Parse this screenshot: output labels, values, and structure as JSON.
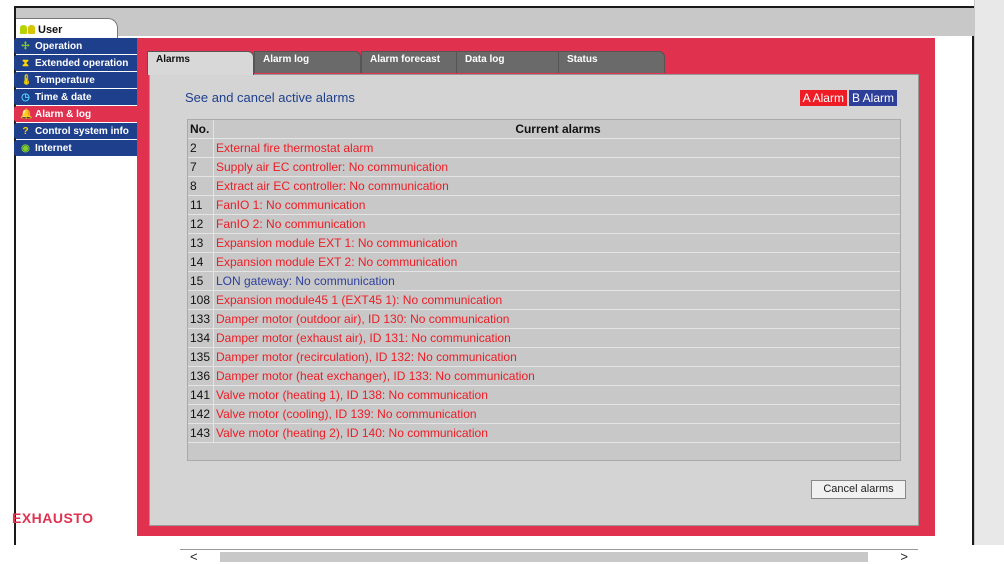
{
  "user_tab": {
    "label": "User"
  },
  "sidebar": {
    "items": [
      {
        "label": "Operation",
        "icon": "fan-icon"
      },
      {
        "label": "Extended operation",
        "icon": "hourglass-icon"
      },
      {
        "label": "Temperature",
        "icon": "thermometer-icon"
      },
      {
        "label": "Time & date",
        "icon": "clock-icon"
      },
      {
        "label": "Alarm & log",
        "icon": "bell-icon",
        "active": true
      },
      {
        "label": "Control system info",
        "icon": "question-icon"
      },
      {
        "label": "Internet",
        "icon": "globe-icon"
      }
    ]
  },
  "logo": {
    "text": "EXHAUSTO"
  },
  "tabs": [
    {
      "label": "Alarms",
      "active": true
    },
    {
      "label": "Alarm log"
    },
    {
      "label": "Alarm forecast"
    },
    {
      "label": "Data log"
    },
    {
      "label": "Status"
    }
  ],
  "main": {
    "heading": "See and cancel active alarms",
    "legend": {
      "a": "A Alarm",
      "b": "B Alarm"
    },
    "table": {
      "col_no": "No.",
      "col_text": "Current alarms",
      "rows": [
        {
          "no": "2",
          "text": "External fire thermostat alarm",
          "class": "A"
        },
        {
          "no": "7",
          "text": "Supply air EC controller: No communication",
          "class": "A"
        },
        {
          "no": "8",
          "text": "Extract air EC controller: No communication",
          "class": "A"
        },
        {
          "no": "11",
          "text": "FanIO 1: No communication",
          "class": "A"
        },
        {
          "no": "12",
          "text": "FanIO 2: No communication",
          "class": "A"
        },
        {
          "no": "13",
          "text": "Expansion module EXT 1: No communication",
          "class": "A"
        },
        {
          "no": "14",
          "text": "Expansion module EXT 2: No communication",
          "class": "A"
        },
        {
          "no": "15",
          "text": "LON gateway: No communication",
          "class": "B"
        },
        {
          "no": "108",
          "text": "Expansion module45 1 (EXT45 1): No communication",
          "class": "A"
        },
        {
          "no": "133",
          "text": "Damper motor (outdoor air), ID 130: No communication",
          "class": "A"
        },
        {
          "no": "134",
          "text": "Damper motor (exhaust air), ID 131: No communication",
          "class": "A"
        },
        {
          "no": "135",
          "text": "Damper motor (recirculation), ID 132: No communication",
          "class": "A"
        },
        {
          "no": "136",
          "text": "Damper motor (heat exchanger), ID 133: No communication",
          "class": "A"
        },
        {
          "no": "141",
          "text": "Valve motor (heating 1), ID 138: No communication",
          "class": "A"
        },
        {
          "no": "142",
          "text": "Valve motor (cooling), ID 139: No communication",
          "class": "A"
        },
        {
          "no": "143",
          "text": "Valve motor (heating 2), ID 140: No communication",
          "class": "A"
        }
      ]
    },
    "cancel_label": "Cancel alarms"
  },
  "scrollbar": {
    "left_arrow": "<",
    "right_arrow": ">"
  },
  "colors": {
    "accent": "#e0314f",
    "nav": "#1e3f8c",
    "alarm_a": "#ee1c25",
    "alarm_b": "#2e3f9a"
  }
}
